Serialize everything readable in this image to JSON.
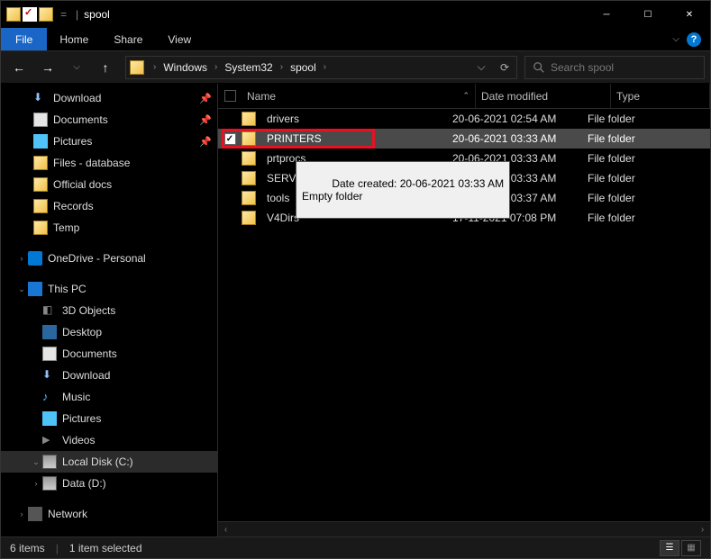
{
  "title": "spool",
  "ribbon": {
    "file": "File",
    "home": "Home",
    "share": "Share",
    "view": "View"
  },
  "breadcrumbs": [
    "Windows",
    "System32",
    "spool"
  ],
  "search": {
    "placeholder": "Search spool"
  },
  "columns": {
    "name": "Name",
    "date": "Date modified",
    "type": "Type"
  },
  "quick_access": [
    {
      "label": "Download",
      "icon": "download",
      "pinned": true
    },
    {
      "label": "Documents",
      "icon": "doc",
      "pinned": true
    },
    {
      "label": "Pictures",
      "icon": "pic",
      "pinned": true
    },
    {
      "label": "Files - database",
      "icon": "folder",
      "pinned": false
    },
    {
      "label": "Official docs",
      "icon": "folder",
      "pinned": false
    },
    {
      "label": "Records",
      "icon": "folder",
      "pinned": false
    },
    {
      "label": "Temp",
      "icon": "folder",
      "pinned": false
    }
  ],
  "onedrive": {
    "label": "OneDrive - Personal"
  },
  "thispc": {
    "label": "This PC",
    "children": [
      {
        "label": "3D Objects",
        "icon": "3d"
      },
      {
        "label": "Desktop",
        "icon": "desk"
      },
      {
        "label": "Documents",
        "icon": "doc"
      },
      {
        "label": "Download",
        "icon": "download"
      },
      {
        "label": "Music",
        "icon": "music"
      },
      {
        "label": "Pictures",
        "icon": "pic"
      },
      {
        "label": "Videos",
        "icon": "vid"
      },
      {
        "label": "Local Disk (C:)",
        "icon": "drive",
        "expanded": true,
        "highlight": true
      },
      {
        "label": "Data (D:)",
        "icon": "drive"
      }
    ]
  },
  "network": {
    "label": "Network"
  },
  "files": [
    {
      "name": "drivers",
      "date": "20-06-2021 02:54 AM",
      "type": "File folder"
    },
    {
      "name": "PRINTERS",
      "date": "20-06-2021 03:33 AM",
      "type": "File folder",
      "selected": true
    },
    {
      "name": "prtprocs",
      "date": "20-06-2021 03:33 AM",
      "type": "File folder"
    },
    {
      "name": "SERVERS",
      "date": "20-06-2021 03:33 AM",
      "type": "File folder"
    },
    {
      "name": "tools",
      "date": "20-06-2021 03:37 AM",
      "type": "File folder"
    },
    {
      "name": "V4Dirs",
      "date": "17-11-2021 07:08 PM",
      "type": "File folder"
    }
  ],
  "tooltip": {
    "line1": "Date created: 20-06-2021 03:33 AM",
    "line2": "Empty folder"
  },
  "status": {
    "count": "6 items",
    "selected": "1 item selected"
  }
}
